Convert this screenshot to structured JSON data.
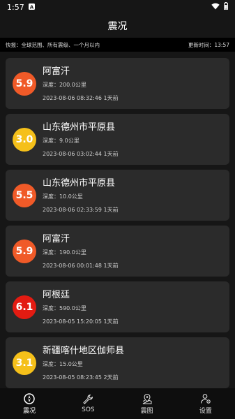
{
  "status_bar": {
    "time": "1:57",
    "app_icon": "notification-a-icon",
    "wifi_icon": "wifi-icon",
    "battery_icon": "battery-icon"
  },
  "app_bar": {
    "title": "震况"
  },
  "info_bar": {
    "left_text": "快报：全球范围、所有震级、一个月以内",
    "right_text": "更新时间：13:57"
  },
  "earthquakes": [
    {
      "magnitude": "5.9",
      "color": "#f05a28",
      "place": "阿富汗",
      "depth": "深度：200.0公里",
      "time": "2023-08-06 08:32:46 1天前"
    },
    {
      "magnitude": "3.0",
      "color": "#f5c01a",
      "place": "山东德州市平原县",
      "depth": "深度：9.0公里",
      "time": "2023-08-06 03:02:44 1天前"
    },
    {
      "magnitude": "5.5",
      "color": "#f05a28",
      "place": "山东德州市平原县",
      "depth": "深度：10.0公里",
      "time": "2023-08-06 02:33:59 1天前"
    },
    {
      "magnitude": "5.9",
      "color": "#f05a28",
      "place": "阿富汗",
      "depth": "深度：190.0公里",
      "time": "2023-08-06 00:01:48 1天前"
    },
    {
      "magnitude": "6.1",
      "color": "#e31b12",
      "place": "阿根廷",
      "depth": "深度：590.0公里",
      "time": "2023-08-05 15:20:05 1天前"
    },
    {
      "magnitude": "3.1",
      "color": "#f5c01a",
      "place": "新疆喀什地区伽师县",
      "depth": "深度：15.0公里",
      "time": "2023-08-05 08:23:45 2天前"
    }
  ],
  "bottom_nav": [
    {
      "label": "震况",
      "icon": "compass-icon",
      "active": true
    },
    {
      "label": "SOS",
      "icon": "wrench-icon",
      "active": false
    },
    {
      "label": "震图",
      "icon": "map-pin-icon",
      "active": false
    },
    {
      "label": "设置",
      "icon": "settings-person-icon",
      "active": false
    }
  ]
}
